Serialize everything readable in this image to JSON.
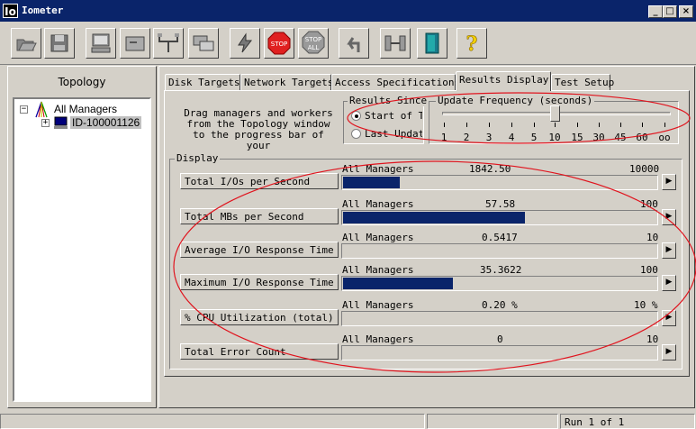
{
  "window": {
    "title": "Iometer",
    "logo": "Io"
  },
  "title_buttons": [
    "_",
    "□",
    "×"
  ],
  "toolbar": {
    "buttons": [
      {
        "name": "open-icon"
      },
      {
        "name": "save-icon"
      },
      {
        "name": "new-disk-worker-icon"
      },
      {
        "name": "new-network-worker-icon"
      },
      {
        "name": "duplicate-worker-icon"
      },
      {
        "name": "disconnect-icon"
      },
      {
        "name": "start-icon"
      },
      {
        "name": "stop-icon",
        "label": "STOP"
      },
      {
        "name": "stop-all-icon",
        "label": "STOP",
        "label2": "ALL"
      },
      {
        "name": "reset-workers-icon"
      },
      {
        "name": "exit-icon"
      },
      {
        "name": "about-icon",
        "label": "?"
      }
    ]
  },
  "topology": {
    "label": "Topology",
    "root": "All Managers",
    "child": "ID-100001126"
  },
  "tabs": [
    "Disk Targets",
    "Network Targets",
    "Access Specifications",
    "Results Display",
    "Test Setup"
  ],
  "active_tab": "Results Display",
  "help_text": [
    "Drag managers and workers",
    "from the Topology window",
    "to the progress bar of your"
  ],
  "results_since": {
    "label": "Results Since",
    "options": [
      "Start of T",
      "Last Update"
    ],
    "selected": "Start of T"
  },
  "update_frequency": {
    "label": "Update Frequency (seconds)",
    "ticks": [
      "1",
      "2",
      "3",
      "4",
      "5",
      "10",
      "15",
      "30",
      "45",
      "60",
      "oo"
    ],
    "selected_index": 5
  },
  "display": {
    "label": "Display",
    "metrics": [
      {
        "button": "Total I/Os per Second",
        "source": "All Managers",
        "value": "1842.50",
        "max": "10000",
        "fill": 0.18
      },
      {
        "button": "Total MBs per Second",
        "source": "All Managers",
        "value": "57.58",
        "max": "100",
        "fill": 0.58
      },
      {
        "button": "Average I/O Response Time (ms)",
        "source": "All Managers",
        "value": "0.5417",
        "max": "10",
        "fill": 0.0
      },
      {
        "button": "Maximum I/O Response Time (ms)",
        "source": "All Managers",
        "value": "35.3622",
        "max": "100",
        "fill": 0.35
      },
      {
        "button": "% CPU Utilization (total)",
        "source": "All Managers",
        "value": "0.20 %",
        "max": "10 %",
        "fill": 0.0
      },
      {
        "button": "Total Error Count",
        "source": "All Managers",
        "value": "0",
        "max": "10",
        "fill": 0.0
      }
    ]
  },
  "status": {
    "run": "Run 1 of 1"
  },
  "colors": {
    "bar": "#0a246a",
    "annotation": "#e0141e",
    "face": "#d4d0c8"
  }
}
